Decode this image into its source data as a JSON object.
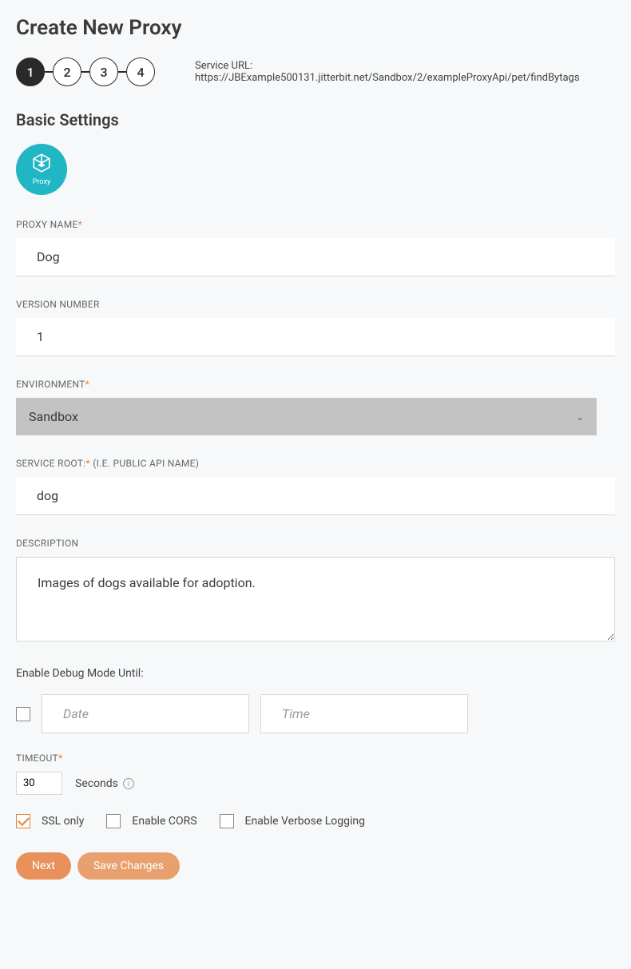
{
  "page_title": "Create New Proxy",
  "stepper": {
    "steps": [
      "1",
      "2",
      "3",
      "4"
    ],
    "active": 0
  },
  "service_url_label": "Service URL: ",
  "service_url_value": "https://JBExample500131.jitterbit.net/Sandbox/2/exampleProxyApi/pet/findBytags",
  "section_title": "Basic Settings",
  "proxy_badge_label": "Proxy",
  "fields": {
    "proxy_name": {
      "label": "PROXY NAME",
      "required": true,
      "value": "Dog"
    },
    "version_number": {
      "label": "VERSION NUMBER",
      "required": false,
      "value": "1"
    },
    "environment": {
      "label": "ENVIRONMENT",
      "required": true,
      "value": "Sandbox"
    },
    "service_root": {
      "label": "SERVICE ROOT:",
      "required": true,
      "hint": " (I.E. PUBLIC API NAME)",
      "value": "dog"
    },
    "description": {
      "label": "DESCRIPTION",
      "required": false,
      "value": "Images of dogs available for adoption."
    },
    "debug": {
      "label": "Enable Debug Mode Until:",
      "date_placeholder": "Date",
      "time_placeholder": "Time"
    },
    "timeout": {
      "label": "TIMEOUT",
      "required": true,
      "value": "30",
      "unit": "Seconds"
    }
  },
  "options": {
    "ssl_only": {
      "label": "SSL only",
      "checked": true
    },
    "enable_cors": {
      "label": "Enable CORS",
      "checked": false
    },
    "verbose_logging": {
      "label": "Enable Verbose Logging",
      "checked": false
    }
  },
  "buttons": {
    "next": "Next",
    "save": "Save Changes"
  }
}
